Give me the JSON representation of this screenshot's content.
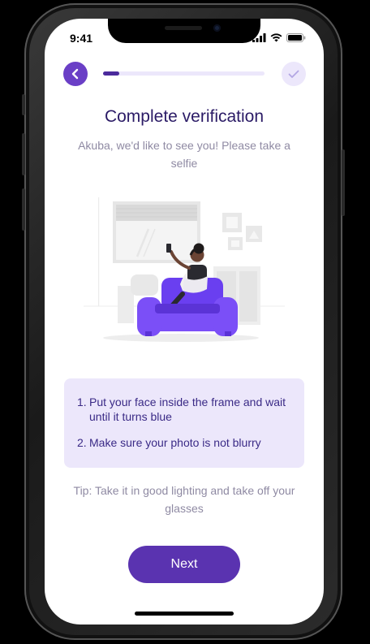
{
  "status_bar": {
    "time": "9:41",
    "icons": [
      "signal-icon",
      "wifi-icon",
      "battery-icon"
    ]
  },
  "header": {
    "back_icon": "chevron-left-icon",
    "progress_fraction": 0.1,
    "done_icon": "check-icon"
  },
  "content": {
    "title": "Complete verification",
    "subtitle": "Akuba, we'd like to see you! Please take a selfie",
    "illustration": "person-taking-selfie-on-sofa-illustration"
  },
  "instructions": {
    "items": [
      {
        "number": "1.",
        "text": "Put your face inside the frame and wait until it turns blue"
      },
      {
        "number": "2.",
        "text": "Make sure your photo is not blurry"
      }
    ]
  },
  "tip": "Tip: Take it in good lighting and take off your glasses",
  "next_button": {
    "label": "Next"
  },
  "colors": {
    "accent": "#5a33b0",
    "accent_light": "#ece7fb",
    "title": "#2b1b66",
    "muted_text": "#8f8aa3"
  }
}
